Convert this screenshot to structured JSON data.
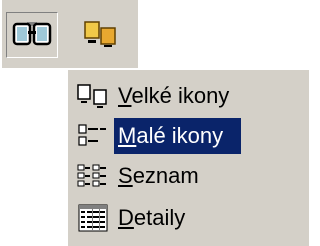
{
  "toolbar": {
    "buttons": [
      {
        "icon": "view-glasses-icon",
        "state": "pressed"
      },
      {
        "icon": "large-icons-icon",
        "state": "normal"
      }
    ]
  },
  "menu": {
    "items": [
      {
        "icon": "large-icons-icon",
        "mnemonic": "V",
        "rest": "elké ikony",
        "selected": false
      },
      {
        "icon": "small-icons-icon",
        "mnemonic": "M",
        "rest": "alé ikony",
        "selected": true
      },
      {
        "icon": "list-icon",
        "mnemonic": "S",
        "rest": "eznam",
        "selected": false
      },
      {
        "icon": "details-icon",
        "mnemonic": "D",
        "rest": "etaily",
        "selected": false
      }
    ]
  },
  "colors": {
    "face": "#d4d0c8",
    "highlight": "#0a246a",
    "highlight_text": "#ffffff",
    "accent_yellow": "#e8b838"
  }
}
